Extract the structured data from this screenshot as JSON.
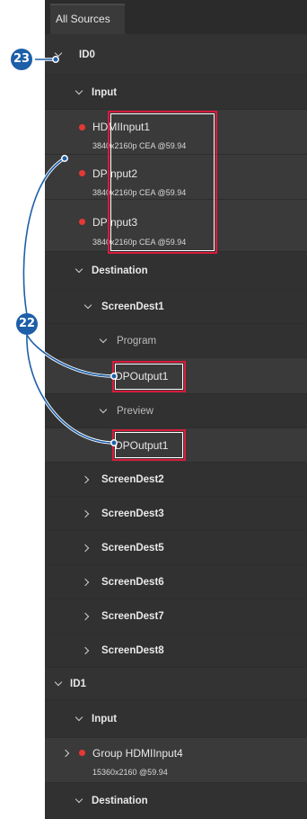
{
  "tab": {
    "label": "All Sources"
  },
  "callouts": {
    "badge_a": "23",
    "badge_b": "22"
  },
  "tree": {
    "id0": "ID0",
    "id0_input": "Input",
    "inputs": [
      {
        "name": "HDMIInput1",
        "res": "3840x2160p CEA @59.94"
      },
      {
        "name": "DPInput2",
        "res": "3840x2160p CEA @59.94"
      },
      {
        "name": "DPInput3",
        "res": "3840x2160p CEA @59.94"
      }
    ],
    "destination": "Destination",
    "screendest1": "ScreenDest1",
    "program": "Program",
    "program_output": "DPOutput1",
    "preview": "Preview",
    "preview_output": "DPOutput1",
    "screendests": [
      "ScreenDest2",
      "ScreenDest3",
      "ScreenDest5",
      "ScreenDest6",
      "ScreenDest7",
      "ScreenDest8"
    ],
    "id1": "ID1",
    "id1_input": "Input",
    "group_input": {
      "name": "Group HDMIInput4",
      "res": "15360x2160 @59.94"
    },
    "id1_destination": "Destination"
  },
  "colors": {
    "status_dot": "#e53935",
    "highlight": "#d81b3c",
    "callout": "#1d5fa8"
  }
}
